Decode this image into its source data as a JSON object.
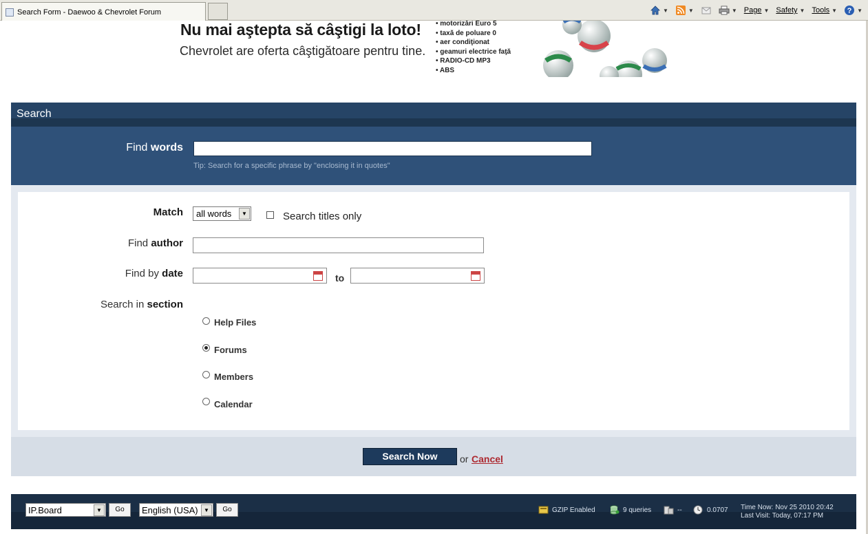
{
  "browser": {
    "tab_title": "Search Form - Daewoo & Chevrolet Forum",
    "menu": {
      "page": "Page",
      "safety": "Safety",
      "tools": "Tools"
    }
  },
  "banner": {
    "headline": "Nu mai aştepta să câştigi la loto!",
    "subline": "Chevrolet are oferta câştigătoare pentru tine.",
    "bullets": [
      "motorizări Euro 5",
      "taxă de poluare 0",
      "aer condiţionat",
      "geamuri electrice faţă",
      "RADIO-CD MP3",
      "ABS"
    ]
  },
  "search": {
    "header": "Search",
    "find_words_prefix": "Find ",
    "find_words_bold": "words",
    "find_words_value": "",
    "tip": "Tip: Search for a specific phrase by \"enclosing it in quotes\"",
    "match_label": "Match",
    "match_value": "all words",
    "titles_only_label": "Search titles only",
    "titles_only_checked": false,
    "author_prefix": "Find ",
    "author_bold": "author",
    "author_value": "",
    "date_prefix": "Find by ",
    "date_bold": "date",
    "date_from": "",
    "date_to": "",
    "to_label": "to",
    "section_prefix": "Search in ",
    "section_bold": "section",
    "sections": [
      {
        "label": "Help Files",
        "checked": false
      },
      {
        "label": "Forums",
        "checked": true
      },
      {
        "label": "Members",
        "checked": false
      },
      {
        "label": "Calendar",
        "checked": false
      }
    ],
    "submit_label": "Search Now",
    "or_text": "or",
    "cancel_label": "Cancel"
  },
  "footer": {
    "skin_select": "IP.Board",
    "language_select": "English (USA)",
    "go_label": "Go",
    "gzip": "GZIP Enabled",
    "queries": "9 queries",
    "server_load": "--",
    "exec_time": "0.0707",
    "time_now": "Time Now: Nov 25 2010 20:42",
    "last_visit": "Last Visit: Today, 07:17 PM"
  },
  "colors": {
    "header_bg": "#264466",
    "panel_bg": "#2f5179",
    "cancel": "#ad2930",
    "footer_bg": "#1b2f46"
  }
}
